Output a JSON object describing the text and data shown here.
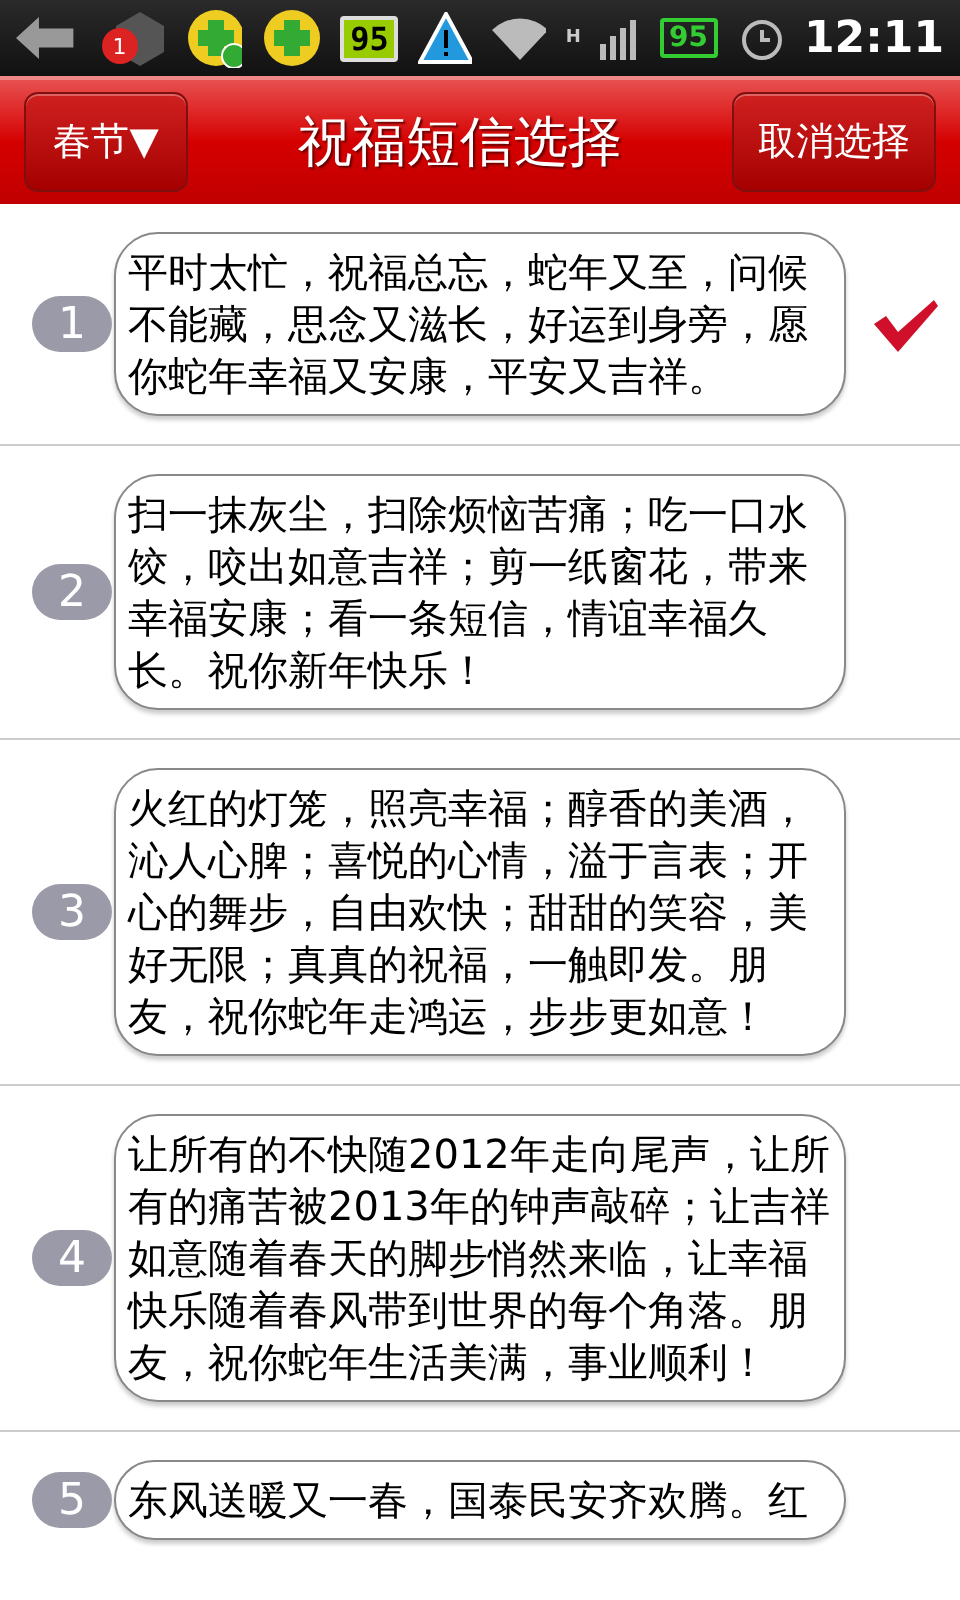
{
  "status_bar": {
    "notification_count": "1",
    "battery_app_level": "95",
    "battery": "95",
    "network": "H",
    "time": "12:11"
  },
  "header": {
    "category_button": "春节▼",
    "title": "祝福短信选择",
    "cancel_button": "取消选择"
  },
  "messages": [
    {
      "number": "1",
      "text": "平时太忙，祝福总忘，蛇年又至，问候不能藏，思念又滋长，好运到身旁，愿你蛇年幸福又安康，平安又吉祥。",
      "selected": true
    },
    {
      "number": "2",
      "text": "扫一抹灰尘，扫除烦恼苦痛；吃一口水饺，咬出如意吉祥；剪一纸窗花，带来幸福安康；看一条短信，情谊幸福久长。祝你新年快乐！",
      "selected": false
    },
    {
      "number": "3",
      "text": "火红的灯笼，照亮幸福；醇香的美酒，沁人心脾；喜悦的心情，溢于言表；开心的舞步，自由欢快；甜甜的笑容，美好无限；真真的祝福，一触即发。朋友，祝你蛇年走鸿运，步步更如意！",
      "selected": false
    },
    {
      "number": "4",
      "text": "让所有的不快随2012年走向尾声，让所有的痛苦被2013年的钟声敲碎；让吉祥如意随着春天的脚步悄然来临，让幸福快乐随着春风带到世界的每个角落。朋友，祝你蛇年生活美满，事业顺利！",
      "selected": false
    },
    {
      "number": "5",
      "text": "东风送暖又一春，国泰民安齐欢腾。红",
      "selected": false
    }
  ]
}
